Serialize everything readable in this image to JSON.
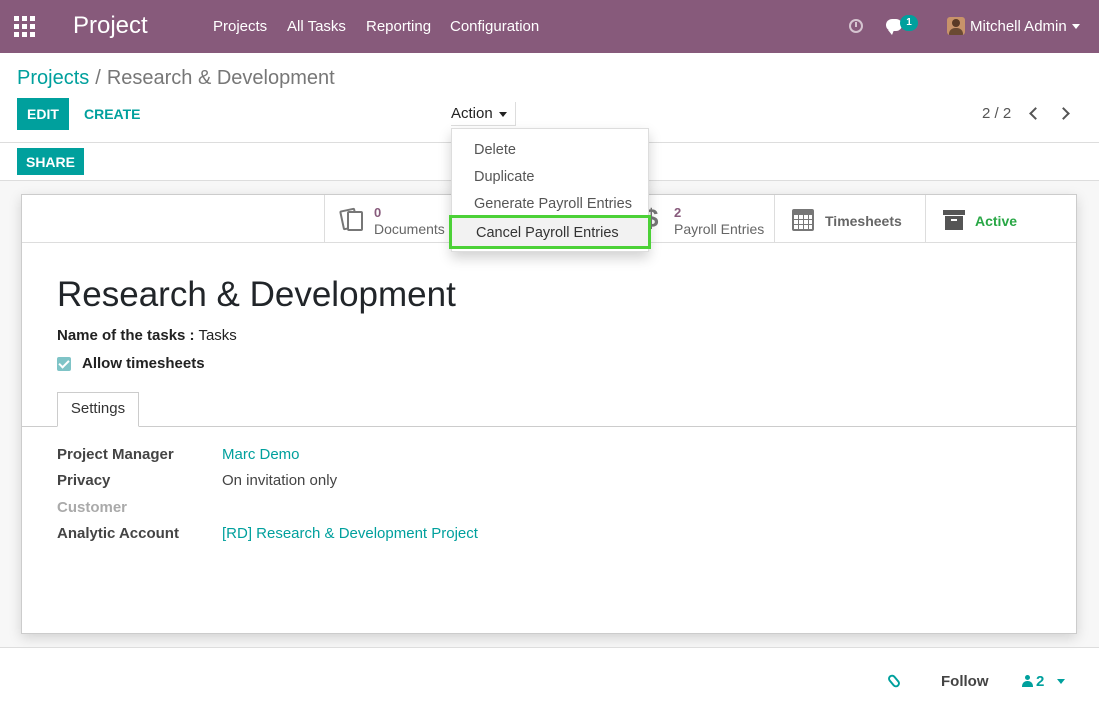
{
  "navbar": {
    "app_title": "Project",
    "menu": [
      "Projects",
      "All Tasks",
      "Reporting",
      "Configuration"
    ],
    "chat_count": "1",
    "user_name": "Mitchell Admin"
  },
  "breadcrumb": {
    "parent": "Projects",
    "separator": "/",
    "current": "Research & Development"
  },
  "buttons": {
    "edit": "EDIT",
    "create": "CREATE",
    "action": "Action",
    "share": "SHARE"
  },
  "pager": {
    "value": "2 / 2"
  },
  "action_menu": {
    "items": [
      "Delete",
      "Duplicate",
      "Generate Payroll Entries",
      "Cancel Payroll Entries"
    ],
    "highlighted": "Cancel Payroll Entries"
  },
  "stat_buttons": {
    "documents": {
      "count": "0",
      "label": "Documents"
    },
    "payroll": {
      "count": "2",
      "label": "Payroll Entries"
    },
    "timesheets": {
      "label": "Timesheets"
    },
    "active": {
      "label": "Active"
    }
  },
  "form": {
    "title": "Research & Development",
    "tasks_label": "Name of the tasks :",
    "tasks_value": "Tasks",
    "allow_timesheets_label": "Allow timesheets",
    "allow_timesheets_checked": true,
    "tab": "Settings",
    "fields": {
      "project_manager_label": "Project Manager",
      "project_manager_value": "Marc Demo",
      "privacy_label": "Privacy",
      "privacy_value": "On invitation only",
      "customer_label": "Customer",
      "analytic_label": "Analytic Account",
      "analytic_value": "[RD] Research & Development Project"
    }
  },
  "chatter": {
    "follow": "Follow",
    "followers_count": "2"
  },
  "colors": {
    "brand": "#875a7b",
    "accent": "#00a09d",
    "highlight_border": "#4cd137",
    "active_status": "#28a745"
  }
}
